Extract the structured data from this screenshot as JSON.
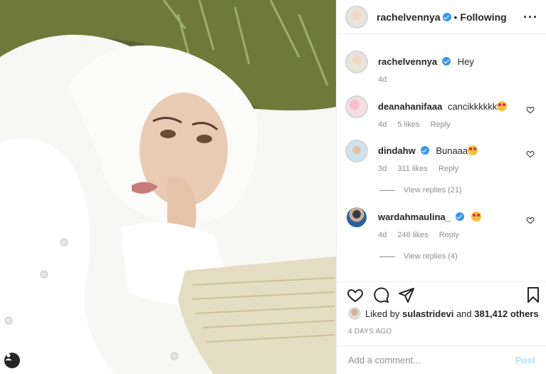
{
  "post": {
    "author": "rachelvennya",
    "follow_status": "Following",
    "separator": "•"
  },
  "comments": [
    {
      "username": "rachelvennya",
      "text": "Hey",
      "time": "4d",
      "likes": "",
      "reply": "",
      "verified": true
    },
    {
      "username": "deanahanifaaa",
      "text": "cancikkkkkk",
      "time": "4d",
      "likes": "5 likes",
      "reply": "Reply",
      "emoji": "heart-eyes-emoji"
    },
    {
      "username": "dindahw",
      "text": "Bunaaa",
      "time": "3d",
      "likes": "311 likes",
      "reply": "Reply",
      "verified": true,
      "emoji": "heart-eyes-emoji",
      "view_replies": "View replies (21)"
    },
    {
      "username": "wardahmaulina_",
      "text": "",
      "time": "4d",
      "likes": "246 likes",
      "reply": "Reply",
      "verified": true,
      "emoji": "heart-eyes-emoji",
      "view_replies": "View replies (4)"
    }
  ],
  "likes": {
    "prefix": "Liked by",
    "user": "sulastridevi",
    "and": "and",
    "others": "381,412 others"
  },
  "timestamp": "4 DAYS AGO",
  "comment_box": {
    "placeholder": "Add a comment...",
    "post_label": "Post"
  },
  "icons": [
    "heart-icon",
    "comment-icon",
    "share-icon",
    "bookmark-icon",
    "more-options-icon",
    "user-tag-icon"
  ],
  "colors": {
    "verified": "#3897f0",
    "muted": "#8e8e8e",
    "post_disabled": "#b2dffc",
    "border": "#efefef"
  }
}
